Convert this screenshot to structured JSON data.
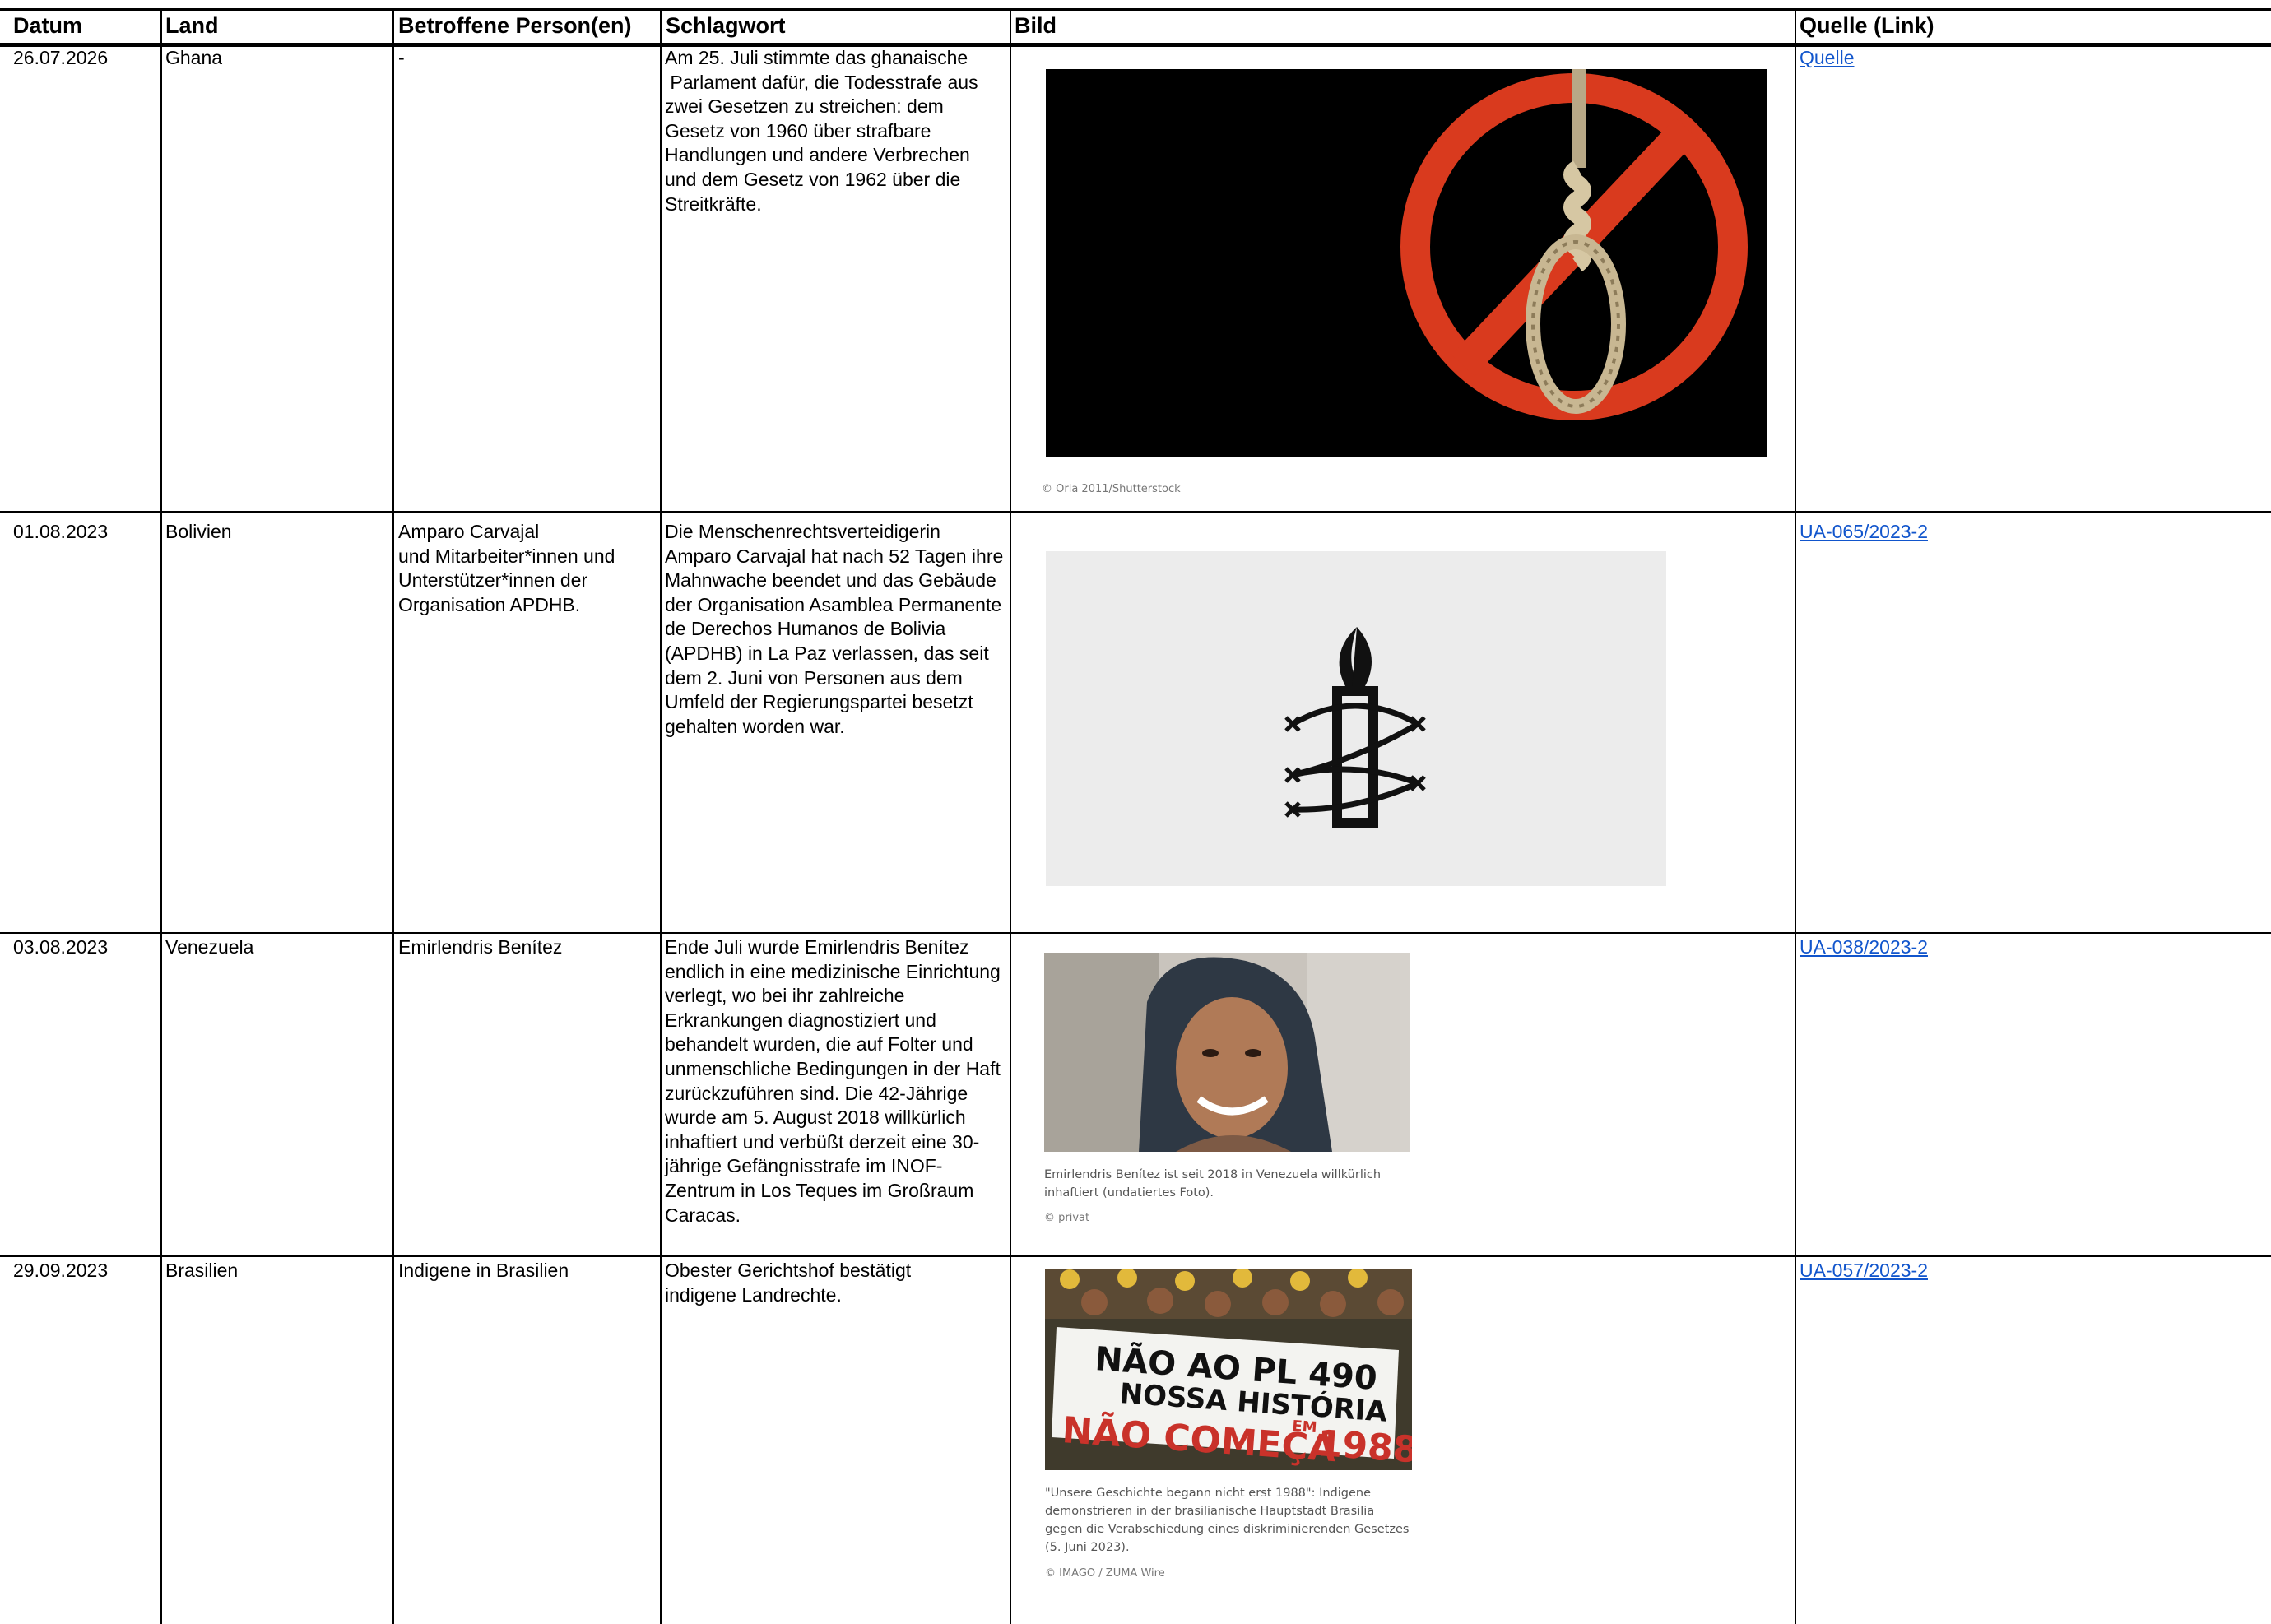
{
  "table": {
    "headers": [
      "Datum",
      "Land",
      "Betroffene Person(en)",
      "Schlagwort",
      "Bild",
      "Quelle (Link)"
    ],
    "rows": [
      {
        "datum": "26.07.2026",
        "land": "Ghana",
        "personen": "-",
        "schlagwort": "Am 25. Juli stimmte das ghanaische\n Parlament dafür, die Todesstrafe aus zwei Gesetzen zu streichen: dem Gesetz von 1960 über strafbare Handlungen und andere Verbrechen und dem Gesetz von 1962 über die Streitkräfte.",
        "bild": {
          "icon": "no-death-penalty-noose-icon",
          "caption": "",
          "credit": "© Orla 2011/Shutterstock"
        },
        "quelle": "Quelle"
      },
      {
        "datum": "01.08.2023",
        "land": "Bolivien",
        "personen": "Amparo Carvajal\nund Mitarbeiter*innen und Unterstützer*innen der Organisation APDHB.",
        "schlagwort": "Die Menschenrechtsverteidigerin Amparo Carvajal hat nach 52 Tagen ihre Mahnwache beendet und das Gebäude der Organisation Asamblea Permanente de Derechos Humanos de Bolivia (APDHB) in La Paz verlassen, das seit dem 2. Juni von Personen aus dem Umfeld der Regierungspartei besetzt gehalten worden war.",
        "bild": {
          "icon": "amnesty-candle-logo-icon",
          "caption": "",
          "credit": ""
        },
        "quelle": "UA-065/2023-2"
      },
      {
        "datum": "03.08.2023",
        "land": "Venezuela",
        "personen": "Emirlendris Benítez",
        "schlagwort": "Ende Juli wurde Emirlendris Benítez endlich in eine medizinische Einrichtung verlegt, wo bei ihr zahlreiche Erkrankungen diagnostiziert und behandelt wurden, die auf Folter und unmenschliche Bedingungen in der Haft zurückzuführen sind. Die 42-Jährige wurde am 5. August 2018 willkürlich inhaftiert und verbüßt derzeit eine 30-jährige Gefängnisstrafe im INOF-Zentrum in Los Teques im Großraum Caracas.",
        "bild": {
          "icon": "portrait-photo-icon",
          "caption": "Emirlendris Benítez ist seit 2018 in Venezuela willkürlich inhaftiert (undatiertes Foto).",
          "credit": "© privat"
        },
        "quelle": "UA-038/2023-2"
      },
      {
        "datum": "29.09.2023",
        "land": "Brasilien",
        "personen": "Indigene in Brasilien",
        "schlagwort": "Obester Gerichtshof bestätigt indigene Landrechte.",
        "bild": {
          "icon": "protest-banner-photo-icon",
          "banner_lines": [
            "NÃO AO PL 490",
            "NOSSA HISTÓRIA",
            "NÃO COMEÇA",
            "EM",
            "1988"
          ],
          "caption": "\"Unsere Geschichte begann nicht erst 1988\": Indigene demonstrieren in der brasilianische Hauptstadt Brasilia gegen die Verabschiedung eines diskriminierenden Gesetzes (5. Juni 2023).",
          "credit": "© IMAGO / ZUMA Wire"
        },
        "quelle": "UA-057/2023-2"
      }
    ]
  },
  "colors": {
    "grid": "#000000",
    "link": "#1155cc",
    "prohibition_red": "#d93a1e"
  }
}
